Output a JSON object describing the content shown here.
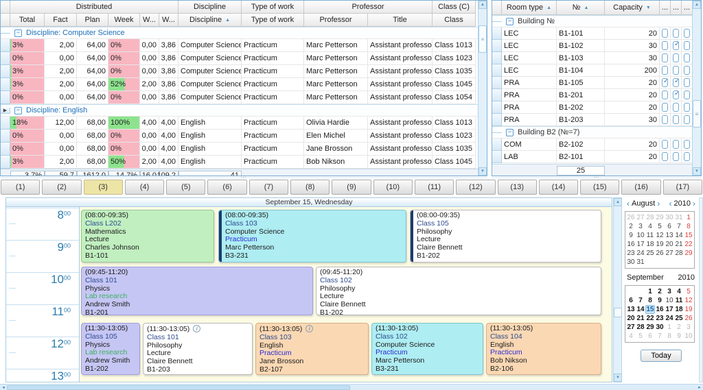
{
  "icons": {
    "sort_asc": "▲",
    "sort_desc": "▼",
    "scroll_up": "▲",
    "scroll_down": "▼",
    "nav_left": "‹",
    "nav_right": "›",
    "collapse": "−",
    "row_marker": "▶",
    "grip": "≡",
    "dots": "⋯",
    "info": "i",
    "scroll_left": "◄",
    "scroll_right": "►"
  },
  "left_grid": {
    "bands": [
      "Distributed",
      "Discipline",
      "Type of work",
      "Professor",
      "Class (C)"
    ],
    "columns": [
      "Total",
      "Fact",
      "Plan",
      "Week",
      "W...",
      "W...",
      "Discipline",
      "Type of work",
      "Professor",
      "Title",
      "Class"
    ],
    "groups": [
      {
        "label": "Discipline: Computer Science",
        "rows": [
          {
            "total": "3%",
            "total_fill": "f3",
            "fact": "2,00",
            "plan": "64,00",
            "week": "0%",
            "week_fill": "f0",
            "w1": "0,00",
            "w2": "3,86",
            "discipline": "Computer Science",
            "type": "Practicum",
            "professor": "Marc Petterson",
            "title": "Assistant professor",
            "class": "Class 1013"
          },
          {
            "total": "0%",
            "total_fill": "f0",
            "fact": "0,00",
            "plan": "64,00",
            "week": "0%",
            "week_fill": "f0",
            "w1": "0,00",
            "w2": "3,86",
            "discipline": "Computer Science",
            "type": "Practicum",
            "professor": "Marc Petterson",
            "title": "Assistant professor",
            "class": "Class 1023"
          },
          {
            "total": "3%",
            "total_fill": "f3",
            "fact": "2,00",
            "plan": "64,00",
            "week": "0%",
            "week_fill": "f0",
            "w1": "0,00",
            "w2": "3,86",
            "discipline": "Computer Science",
            "type": "Practicum",
            "professor": "Marc Petterson",
            "title": "Assistant professor",
            "class": "Class 1035"
          },
          {
            "total": "3%",
            "total_fill": "f3",
            "fact": "2,00",
            "plan": "64,00",
            "week": "52%",
            "week_fill": "f52",
            "w1": "2,00",
            "w2": "3,86",
            "discipline": "Computer Science",
            "type": "Practicum",
            "professor": "Marc Petterson",
            "title": "Assistant professor",
            "class": "Class 1045"
          },
          {
            "total": "0%",
            "total_fill": "f0",
            "fact": "0,00",
            "plan": "64,00",
            "week": "0%",
            "week_fill": "f0",
            "w1": "0,00",
            "w2": "3,86",
            "discipline": "Computer Science",
            "type": "Practicum",
            "professor": "Marc Petterson",
            "title": "Assistant professor",
            "class": "Class 1054"
          }
        ]
      },
      {
        "label": "Discipline: English",
        "rows": [
          {
            "total": "18%",
            "total_fill": "f18",
            "fact": "12,00",
            "plan": "68,00",
            "week": "100%",
            "week_fill": "f100",
            "w1": "4,00",
            "w2": "4,00",
            "discipline": "English",
            "type": "Practicum",
            "professor": "Olivia Hardie",
            "title": "Assistant professor",
            "class": "Class 1013"
          },
          {
            "total": "0%",
            "total_fill": "f0",
            "fact": "0,00",
            "plan": "68,00",
            "week": "0%",
            "week_fill": "f0",
            "w1": "0,00",
            "w2": "4,00",
            "discipline": "English",
            "type": "Practicum",
            "professor": "Elen Michel",
            "title": "Assistant professor",
            "class": "Class 1023"
          },
          {
            "total": "0%",
            "total_fill": "f0",
            "fact": "0,00",
            "plan": "68,00",
            "week": "0%",
            "week_fill": "f0",
            "w1": "0,00",
            "w2": "4,00",
            "discipline": "English",
            "type": "Practicum",
            "professor": "Jane Brosson",
            "title": "Assistant professor",
            "class": "Class 1035"
          },
          {
            "total": "3%",
            "total_fill": "f3",
            "fact": "2,00",
            "plan": "68,00",
            "week": "50%",
            "week_fill": "f50",
            "w1": "2,00",
            "w2": "4,00",
            "discipline": "English",
            "type": "Practicum",
            "professor": "Bob Nikson",
            "title": "Assistant professor",
            "class": "Class 1045"
          }
        ]
      }
    ],
    "summary": [
      "3,7%",
      "59,7",
      "1612,0",
      "14,7%",
      "16,0",
      "109,2",
      "41"
    ]
  },
  "right_grid": {
    "columns": [
      "Room type",
      "№",
      "Capacity",
      "...",
      "...",
      "..."
    ],
    "groups": [
      {
        "label": "Building №",
        "rows": [
          {
            "type": "LEC",
            "num": "B1-101",
            "cap": "20",
            "cb1": "",
            "cb2": "",
            "cb3": ""
          },
          {
            "type": "LEC",
            "num": "B1-102",
            "cap": "30",
            "cb1": "",
            "cb2": "checked",
            "cb3": ""
          },
          {
            "type": "LEC",
            "num": "B1-103",
            "cap": "30",
            "cb1": "",
            "cb2": "",
            "cb3": ""
          },
          {
            "type": "LEC",
            "num": "B1-104",
            "cap": "200",
            "cb1": "",
            "cb2": "",
            "cb3": ""
          },
          {
            "type": "PRA",
            "num": "B1-105",
            "cap": "20",
            "cb1": "checked",
            "cb2": "checked",
            "cb3": ""
          },
          {
            "type": "PRA",
            "num": "B1-201",
            "cap": "20",
            "cb1": "",
            "cb2": "checked",
            "cb3": ""
          },
          {
            "type": "PRA",
            "num": "B1-202",
            "cap": "20",
            "cb1": "",
            "cb2": "",
            "cb3": ""
          },
          {
            "type": "PRA",
            "num": "B1-203",
            "cap": "30",
            "cb1": "",
            "cb2": "",
            "cb3": ""
          }
        ]
      },
      {
        "label": "Building B2 (№=7)",
        "rows": [
          {
            "type": "COM",
            "num": "B2-102",
            "cap": "20",
            "cb1": "",
            "cb2": "",
            "cb3": ""
          },
          {
            "type": "LAB",
            "num": "B2-101",
            "cap": "20",
            "cb1": "",
            "cb2": "",
            "cb3": ""
          }
        ]
      }
    ],
    "summary": "25"
  },
  "tabs": [
    {
      "label": "(1)",
      "state": ""
    },
    {
      "label": "(2)",
      "state": ""
    },
    {
      "label": "(3)",
      "state": "active"
    },
    {
      "label": "(4)",
      "state": ""
    },
    {
      "label": "(5)",
      "state": ""
    },
    {
      "label": "(6)",
      "state": ""
    },
    {
      "label": "(7)",
      "state": ""
    },
    {
      "label": "(8)",
      "state": ""
    },
    {
      "label": "(9)",
      "state": ""
    },
    {
      "label": "(10)",
      "state": ""
    },
    {
      "label": "(11)",
      "state": ""
    },
    {
      "label": "(12)",
      "state": ""
    },
    {
      "label": "(13)",
      "state": ""
    },
    {
      "label": "(14)",
      "state": ""
    },
    {
      "label": "(15)",
      "state": ""
    },
    {
      "label": "(16)",
      "state": ""
    },
    {
      "label": "(17)",
      "state": ""
    }
  ],
  "scheduler": {
    "day_header": "September 15, Wednesday",
    "hours": [
      {
        "h": "8",
        "m": "00"
      },
      {
        "h": "9",
        "m": "00"
      },
      {
        "h": "10",
        "m": "00"
      },
      {
        "h": "11",
        "m": "00"
      },
      {
        "h": "12",
        "m": "00"
      },
      {
        "h": "13",
        "m": "00"
      }
    ],
    "events": [
      {
        "time": "(08:00-09:35)",
        "class": "Class L202",
        "subject": "Mathematics",
        "type": "Lecture",
        "type_cls": "",
        "professor": "Charles Johnson",
        "room": "B1-101",
        "color": "green"
      },
      {
        "time": "(08:00-09:35)",
        "class": "Class 103",
        "subject": "Computer Science",
        "type": "Practicum",
        "type_cls": "practicum",
        "professor": "Marc Petterson",
        "room": "B3-231",
        "color": "cyan strip"
      },
      {
        "time": "(08:00-09:35)",
        "class": "Class 105",
        "subject": "Philosophy",
        "type": "Lecture",
        "type_cls": "",
        "professor": "Claire Bennett",
        "room": "B1-202",
        "color": "white strip"
      },
      {
        "time": "(09:45-11:20)",
        "class": "Class 101",
        "subject": "Physics",
        "type": "Lab research",
        "type_cls": "lab",
        "professor": "Andrew Smith",
        "room": "B1-201",
        "color": "lavender"
      },
      {
        "time": "(09:45-11:20)",
        "class": "Class 102",
        "subject": "Philosophy",
        "type": "Lecture",
        "type_cls": "",
        "professor": "Claire Bennett",
        "room": "B1-202",
        "color": "white"
      },
      {
        "time": "(11:30-13:05)",
        "class": "Class 105",
        "subject": "Physics",
        "type": "Lab research",
        "type_cls": "lab",
        "professor": "Andrew Smith",
        "room": "B1-202",
        "color": "lavender"
      },
      {
        "time": "(11:30-13:05)",
        "icon": "i",
        "class": "Class 101",
        "subject": "Philosophy",
        "type": "Lecture",
        "type_cls": "",
        "professor": "Claire Bennett",
        "room": "B1-203",
        "color": "white"
      },
      {
        "time": "(11:30-13:05)",
        "icon": "i",
        "class": "Class 103",
        "subject": "English",
        "type": "Practicum",
        "type_cls": "practicum",
        "professor": "Jane Brosson",
        "room": "B2-107",
        "color": "peach"
      },
      {
        "time": "(11:30-13:05)",
        "class": "Class 102",
        "subject": "Computer Science",
        "type": "Practicum",
        "type_cls": "practicum",
        "professor": "Marc Petterson",
        "room": "B3-231",
        "color": "cyan"
      },
      {
        "time": "(11:30-13:05)",
        "class": "Class 104",
        "subject": "English",
        "type": "Practicum",
        "type_cls": "practicum",
        "professor": "Bob Nikson",
        "room": "B2-106",
        "color": "peach"
      }
    ]
  },
  "calendar": {
    "aug": {
      "month": "August",
      "year": "2010",
      "days": [
        {
          "d": "26",
          "c": "out"
        },
        {
          "d": "27",
          "c": "out"
        },
        {
          "d": "28",
          "c": "out"
        },
        {
          "d": "29",
          "c": "out"
        },
        {
          "d": "30",
          "c": "out"
        },
        {
          "d": "31",
          "c": "out"
        },
        {
          "d": "1",
          "c": "sun"
        },
        {
          "d": "2",
          "c": ""
        },
        {
          "d": "3",
          "c": ""
        },
        {
          "d": "4",
          "c": ""
        },
        {
          "d": "5",
          "c": ""
        },
        {
          "d": "6",
          "c": ""
        },
        {
          "d": "7",
          "c": ""
        },
        {
          "d": "8",
          "c": "sun"
        },
        {
          "d": "9",
          "c": ""
        },
        {
          "d": "10",
          "c": ""
        },
        {
          "d": "11",
          "c": ""
        },
        {
          "d": "12",
          "c": ""
        },
        {
          "d": "13",
          "c": ""
        },
        {
          "d": "14",
          "c": ""
        },
        {
          "d": "15",
          "c": "sun"
        },
        {
          "d": "16",
          "c": ""
        },
        {
          "d": "17",
          "c": ""
        },
        {
          "d": "18",
          "c": ""
        },
        {
          "d": "19",
          "c": ""
        },
        {
          "d": "20",
          "c": ""
        },
        {
          "d": "21",
          "c": ""
        },
        {
          "d": "22",
          "c": "sun"
        },
        {
          "d": "23",
          "c": ""
        },
        {
          "d": "24",
          "c": ""
        },
        {
          "d": "25",
          "c": ""
        },
        {
          "d": "26",
          "c": ""
        },
        {
          "d": "27",
          "c": ""
        },
        {
          "d": "28",
          "c": ""
        },
        {
          "d": "29",
          "c": "sun"
        },
        {
          "d": "30",
          "c": ""
        },
        {
          "d": "31",
          "c": ""
        },
        {
          "d": "",
          "c": ""
        },
        {
          "d": "",
          "c": ""
        },
        {
          "d": "",
          "c": ""
        },
        {
          "d": "",
          "c": ""
        },
        {
          "d": "",
          "c": ""
        }
      ]
    },
    "sep": {
      "month": "September",
      "year": "2010",
      "days": [
        {
          "d": "",
          "c": ""
        },
        {
          "d": "",
          "c": ""
        },
        {
          "d": "1",
          "c": "bold"
        },
        {
          "d": "2",
          "c": "bold"
        },
        {
          "d": "3",
          "c": "bold"
        },
        {
          "d": "4",
          "c": "bold"
        },
        {
          "d": "5",
          "c": "sun"
        },
        {
          "d": "6",
          "c": "bold"
        },
        {
          "d": "7",
          "c": "bold"
        },
        {
          "d": "8",
          "c": "bold"
        },
        {
          "d": "9",
          "c": "bold"
        },
        {
          "d": "10",
          "c": ""
        },
        {
          "d": "11",
          "c": "bold"
        },
        {
          "d": "12",
          "c": "sun"
        },
        {
          "d": "13",
          "c": "bold"
        },
        {
          "d": "14",
          "c": "bold"
        },
        {
          "d": "15",
          "c": "sel"
        },
        {
          "d": "16",
          "c": "bold"
        },
        {
          "d": "17",
          "c": "bold"
        },
        {
          "d": "18",
          "c": "bold"
        },
        {
          "d": "19",
          "c": "sun"
        },
        {
          "d": "20",
          "c": "bold"
        },
        {
          "d": "21",
          "c": "bold"
        },
        {
          "d": "22",
          "c": "bold"
        },
        {
          "d": "23",
          "c": "bold"
        },
        {
          "d": "24",
          "c": "bold"
        },
        {
          "d": "25",
          "c": "bold"
        },
        {
          "d": "26",
          "c": "sun"
        },
        {
          "d": "27",
          "c": "bold"
        },
        {
          "d": "28",
          "c": "bold"
        },
        {
          "d": "29",
          "c": "bold"
        },
        {
          "d": "30",
          "c": "bold"
        },
        {
          "d": "1",
          "c": "out"
        },
        {
          "d": "2",
          "c": "out"
        },
        {
          "d": "3",
          "c": "out"
        },
        {
          "d": "4",
          "c": "out"
        },
        {
          "d": "5",
          "c": "out"
        },
        {
          "d": "6",
          "c": "out"
        },
        {
          "d": "7",
          "c": "out"
        },
        {
          "d": "8",
          "c": "out"
        },
        {
          "d": "9",
          "c": "out"
        },
        {
          "d": "10",
          "c": "out"
        }
      ]
    },
    "today_label": "Today"
  }
}
